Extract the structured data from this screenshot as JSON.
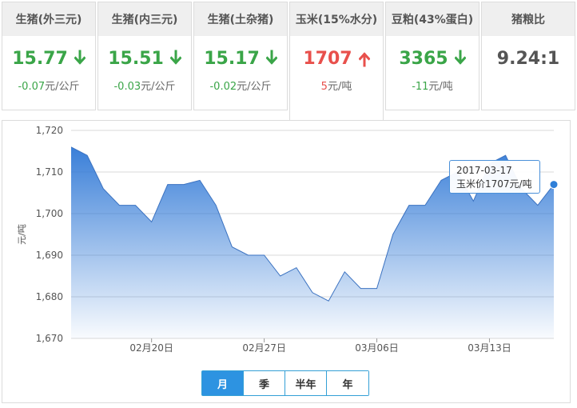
{
  "cards": [
    {
      "title": "生猪(外三元)",
      "value": "15.77",
      "trend": "down",
      "change_num": "-0.07",
      "change_unit": "元/公斤",
      "color": "#3aa548"
    },
    {
      "title": "生猪(内三元)",
      "value": "15.51",
      "trend": "down",
      "change_num": "-0.03",
      "change_unit": "元/公斤",
      "color": "#3aa548"
    },
    {
      "title": "生猪(土杂猪)",
      "value": "15.17",
      "trend": "down",
      "change_num": "-0.02",
      "change_unit": "元/公斤",
      "color": "#3aa548"
    },
    {
      "title": "玉米(15%水分)",
      "value": "1707",
      "trend": "up",
      "change_num": "5",
      "change_unit": "元/吨",
      "color": "#e8504c"
    },
    {
      "title": "豆粕(43%蛋白)",
      "value": "3365",
      "trend": "down",
      "change_num": "-11",
      "change_unit": "元/吨",
      "color": "#3aa548"
    },
    {
      "title": "猪粮比",
      "value": "9.24:1",
      "trend": "none",
      "change_num": "",
      "change_unit": "",
      "color": "#555555"
    }
  ],
  "chart_data": {
    "type": "area",
    "ylabel": "元/吨",
    "ylim": [
      1670,
      1720
    ],
    "yticks": [
      "1,720",
      "1,710",
      "1,700",
      "1,690",
      "1,680",
      "1,670"
    ],
    "xticks": [
      "02月20日",
      "02月27日",
      "03月06日",
      "03月13日"
    ],
    "x": [
      "02-15",
      "02-16",
      "02-17",
      "02-18",
      "02-19",
      "02-20",
      "02-21",
      "02-22",
      "02-23",
      "02-24",
      "02-25",
      "02-26",
      "02-27",
      "02-28",
      "03-01",
      "03-02",
      "03-03",
      "03-04",
      "03-05",
      "03-06",
      "03-07",
      "03-08",
      "03-09",
      "03-10",
      "03-11",
      "03-12",
      "03-13",
      "03-14",
      "03-15",
      "03-16",
      "03-17"
    ],
    "values": [
      1716,
      1714,
      1706,
      1702,
      1702,
      1698,
      1707,
      1707,
      1708,
      1702,
      1692,
      1690,
      1690,
      1685,
      1687,
      1681,
      1679,
      1686,
      1682,
      1682,
      1695,
      1702,
      1702,
      1708,
      1710,
      1703,
      1712,
      1714,
      1706,
      1702,
      1707
    ],
    "series_color": "#3b82d8",
    "grid": true
  },
  "tooltip": {
    "date": "2017-03-17",
    "text": "玉米价1707元/吨"
  },
  "range_buttons": [
    "月",
    "季",
    "半年",
    "年"
  ],
  "active_range": "月"
}
